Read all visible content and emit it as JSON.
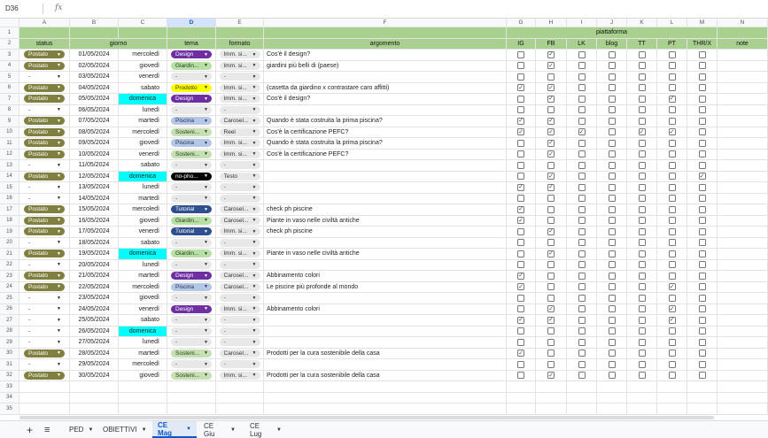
{
  "formula_bar": {
    "cell_ref": "D36",
    "fx_label": "fx"
  },
  "columns": [
    "A",
    "B",
    "C",
    "D",
    "E",
    "F",
    "G",
    "H",
    "I",
    "J",
    "K",
    "L",
    "M",
    "N"
  ],
  "selected_column": "D",
  "header_labels": {
    "status": "status",
    "giorno": "giorno",
    "tema": "tema",
    "formato": "formato",
    "argomento": "argomento",
    "piattaforma": "piattaforma",
    "note": "note"
  },
  "platforms": [
    "IG",
    "FB",
    "LK",
    "blog",
    "TT",
    "PT",
    "THR/X"
  ],
  "row_numbers": [
    "1",
    "2",
    "3",
    "4",
    "5",
    "6",
    "7",
    "8",
    "9",
    "10",
    "11",
    "12",
    "13",
    "14",
    "15",
    "16",
    "17",
    "18",
    "19",
    "20",
    "21",
    "22",
    "23",
    "24",
    "25",
    "26",
    "27",
    "28",
    "29",
    "30",
    "31",
    "32",
    "33",
    "34",
    "35"
  ],
  "rows": [
    {
      "status": "Postato",
      "date": "01/05/2024",
      "weekday": "mercoledì",
      "tema": "Design",
      "formato": "Imm. si...",
      "argomento": "Cos'è il design?",
      "checks": [
        0,
        1,
        0,
        0,
        0,
        0,
        0
      ]
    },
    {
      "status": "Postato",
      "date": "02/05/2024",
      "weekday": "giovedì",
      "tema": "Giardin...",
      "formato": "Imm. si...",
      "argomento": "giardini più belli di (paese)",
      "checks": [
        0,
        1,
        0,
        0,
        0,
        0,
        0
      ]
    },
    {
      "status": "-",
      "date": "03/05/2024",
      "weekday": "venerdì",
      "tema": "-",
      "formato": "-",
      "argomento": "",
      "checks": [
        0,
        0,
        0,
        0,
        0,
        0,
        0
      ]
    },
    {
      "status": "Postato",
      "date": "04/05/2024",
      "weekday": "sabato",
      "tema": "Prodotto",
      "formato": "Imm. si...",
      "argomento": "(casetta da giardino x contrastare caro affitti)",
      "checks": [
        1,
        1,
        0,
        0,
        0,
        0,
        0
      ]
    },
    {
      "status": "Postato",
      "date": "05/05/2024",
      "weekday": "domenica",
      "tema": "Design",
      "formato": "Imm. si...",
      "argomento": "Cos'è il design?",
      "checks": [
        0,
        1,
        0,
        0,
        0,
        1,
        0
      ]
    },
    {
      "status": "-",
      "date": "06/05/2024",
      "weekday": "lunedì",
      "tema": "-",
      "formato": "-",
      "argomento": "",
      "checks": [
        0,
        0,
        0,
        0,
        0,
        0,
        0
      ]
    },
    {
      "status": "Postato",
      "date": "07/05/2024",
      "weekday": "martedì",
      "tema": "Piscina",
      "formato": "Carosel...",
      "argomento": "Quando è stata costruita la prima piscina?",
      "checks": [
        1,
        1,
        0,
        0,
        0,
        0,
        0
      ]
    },
    {
      "status": "Postato",
      "date": "08/05/2024",
      "weekday": "mercoledì",
      "tema": "Sosteni...",
      "formato": "Reel",
      "argomento": "Cos'è la certificazione PEFC?",
      "checks": [
        1,
        1,
        1,
        0,
        1,
        1,
        0
      ]
    },
    {
      "status": "Postato",
      "date": "09/05/2024",
      "weekday": "giovedì",
      "tema": "Piscina",
      "formato": "Imm. si...",
      "argomento": "Quando è stata costruita la prima piscina?",
      "checks": [
        0,
        1,
        0,
        0,
        0,
        0,
        0
      ]
    },
    {
      "status": "Postato",
      "date": "10/05/2024",
      "weekday": "venerdì",
      "tema": "Sosteni...",
      "formato": "Imm. si...",
      "argomento": "Cos'è la certificazione PEFC?",
      "checks": [
        0,
        1,
        0,
        0,
        0,
        0,
        0
      ]
    },
    {
      "status": "-",
      "date": "11/05/2024",
      "weekday": "sabato",
      "tema": "-",
      "formato": "-",
      "argomento": "",
      "checks": [
        0,
        0,
        0,
        0,
        0,
        0,
        0
      ]
    },
    {
      "status": "Postato",
      "date": "12/05/2024",
      "weekday": "domenica",
      "tema": "no-pho...",
      "formato": "Testo",
      "argomento": "",
      "checks": [
        0,
        1,
        0,
        0,
        0,
        0,
        1
      ]
    },
    {
      "status": "-",
      "date": "13/05/2024",
      "weekday": "lunedì",
      "tema": "-",
      "formato": "-",
      "argomento": "",
      "checks": [
        1,
        1,
        0,
        0,
        0,
        0,
        0
      ]
    },
    {
      "status": "-",
      "date": "14/05/2024",
      "weekday": "martedì",
      "tema": "-",
      "formato": "-",
      "argomento": "",
      "checks": [
        0,
        0,
        0,
        0,
        0,
        0,
        0
      ]
    },
    {
      "status": "Postato",
      "date": "15/05/2024",
      "weekday": "mercoledì",
      "tema": "Tutorial",
      "formato": "Carosel...",
      "argomento": "check ph piscine",
      "checks": [
        1,
        0,
        0,
        0,
        0,
        0,
        0
      ]
    },
    {
      "status": "Postato",
      "date": "16/05/2024",
      "weekday": "giovedì",
      "tema": "Giardin...",
      "formato": "Carosel...",
      "argomento": "Piante in vaso nelle civiltà antiche",
      "checks": [
        1,
        0,
        0,
        0,
        0,
        0,
        0
      ]
    },
    {
      "status": "Postato",
      "date": "17/05/2024",
      "weekday": "venerdì",
      "tema": "Tutorial",
      "formato": "Imm. si...",
      "argomento": "check ph piscine",
      "checks": [
        0,
        1,
        0,
        0,
        0,
        0,
        0
      ]
    },
    {
      "status": "-",
      "date": "18/05/2024",
      "weekday": "sabato",
      "tema": "-",
      "formato": "-",
      "argomento": "",
      "checks": [
        0,
        0,
        0,
        0,
        0,
        0,
        0
      ]
    },
    {
      "status": "Postato",
      "date": "19/05/2024",
      "weekday": "domenica",
      "tema": "Giardin...",
      "formato": "Imm. si...",
      "argomento": "Piante in vaso nelle civiltà antiche",
      "checks": [
        0,
        1,
        0,
        0,
        0,
        0,
        0
      ]
    },
    {
      "status": "-",
      "date": "20/05/2024",
      "weekday": "lunedì",
      "tema": "-",
      "formato": "-",
      "argomento": "",
      "checks": [
        0,
        0,
        0,
        0,
        0,
        0,
        0
      ]
    },
    {
      "status": "Postato",
      "date": "21/05/2024",
      "weekday": "martedì",
      "tema": "Design",
      "formato": "Carosel...",
      "argomento": "Abbinamento colori",
      "checks": [
        1,
        0,
        0,
        0,
        0,
        0,
        0
      ]
    },
    {
      "status": "Postato",
      "date": "22/05/2024",
      "weekday": "mercoledì",
      "tema": "Piscina",
      "formato": "Carosel...",
      "argomento": "Le piscine più profonde al mondo",
      "checks": [
        1,
        0,
        0,
        0,
        0,
        1,
        0
      ]
    },
    {
      "status": "-",
      "date": "23/05/2024",
      "weekday": "giovedì",
      "tema": "-",
      "formato": "-",
      "argomento": "",
      "checks": [
        0,
        0,
        0,
        0,
        0,
        0,
        0
      ]
    },
    {
      "status": "-",
      "date": "24/05/2024",
      "weekday": "venerdì",
      "tema": "Design",
      "formato": "Imm. si...",
      "argomento": "Abbinamento colori",
      "checks": [
        0,
        1,
        0,
        0,
        0,
        1,
        0
      ]
    },
    {
      "status": "-",
      "date": "25/05/2024",
      "weekday": "sabato",
      "tema": "-",
      "formato": "-",
      "argomento": "",
      "checks": [
        1,
        1,
        0,
        0,
        0,
        1,
        0
      ]
    },
    {
      "status": "-",
      "date": "26/05/2024",
      "weekday": "domenica",
      "tema": "-",
      "formato": "-",
      "argomento": "",
      "checks": [
        0,
        0,
        0,
        0,
        0,
        0,
        0
      ]
    },
    {
      "status": "-",
      "date": "27/05/2024",
      "weekday": "lunedì",
      "tema": "-",
      "formato": "-",
      "argomento": "",
      "checks": [
        0,
        0,
        0,
        0,
        0,
        0,
        0
      ]
    },
    {
      "status": "Postato",
      "date": "28/05/2024",
      "weekday": "martedì",
      "tema": "Sosteni...",
      "formato": "Carosel...",
      "argomento": "Prodotti per la cura sostenibile della casa",
      "checks": [
        1,
        0,
        0,
        0,
        0,
        0,
        0
      ]
    },
    {
      "status": "-",
      "date": "29/05/2024",
      "weekday": "mercoledì",
      "tema": "-",
      "formato": "-",
      "argomento": "",
      "checks": [
        0,
        0,
        0,
        0,
        0,
        0,
        0
      ]
    },
    {
      "status": "Postato",
      "date": "30/05/2024",
      "weekday": "giovedì",
      "tema": "Sosteni...",
      "formato": "Imm. si...",
      "argomento": "Prodotti per la cura sostenibile della casa",
      "checks": [
        0,
        1,
        0,
        0,
        0,
        0,
        0
      ]
    }
  ],
  "colors": {
    "header_green": "#a9d08e",
    "postato_bg": "#7f7f3f",
    "domenica_cyan": "#00ffff",
    "design": "#6e2fa3",
    "giardino": "#b7dfa6",
    "prodotto": "#ffff00",
    "piscina": "#b4c7e7",
    "sostenibilita": "#c6e0b4",
    "tutorial": "#2f4f8f",
    "nophoto": "#000000",
    "dash_pill": "#e8e8e8"
  },
  "sheet_tabs": [
    {
      "label": "PED",
      "active": false
    },
    {
      "label": "OBIETTIVI",
      "active": false
    },
    {
      "label": "CE Mag",
      "active": true
    },
    {
      "label": "CE Giu",
      "active": false
    },
    {
      "label": "CE Lug",
      "active": false
    }
  ],
  "tabbar": {
    "add_label": "+",
    "menu_label": "≡"
  }
}
